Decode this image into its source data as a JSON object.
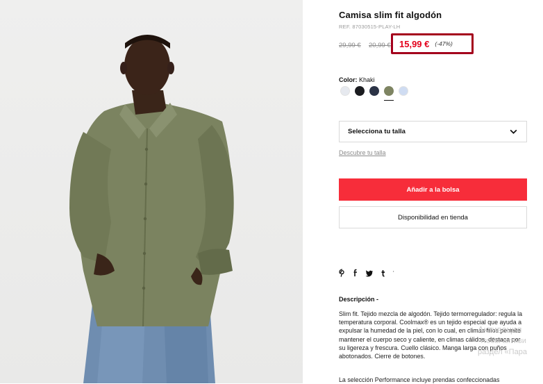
{
  "product": {
    "title": "Camisa slim fit algodón",
    "ref": "REF. 87030515-PLAY-LH",
    "old_price_1": "29,99 €",
    "old_price_2": "20,99 €",
    "price": "15,99 €",
    "discount": "(-47%)",
    "color_label": "Color:",
    "color_value": "Khaki",
    "swatches": [
      {
        "name": "white",
        "color": "#e6e9ef"
      },
      {
        "name": "black",
        "color": "#1b1c20"
      },
      {
        "name": "navy",
        "color": "#2b3346"
      },
      {
        "name": "khaki",
        "color": "#7e8462",
        "selected": true
      },
      {
        "name": "light-blue",
        "color": "#cfdcf2"
      }
    ],
    "size_select": "Selecciona tu talla",
    "size_link": "Descubre tu talla",
    "add_button": "Añadir a la bolsa",
    "store_button": "Disponibilidad en tienda",
    "social": [
      "p",
      "f",
      "t",
      "t"
    ],
    "description_title": "Descripción  -",
    "description": "Slim fit. Tejido mezcla de algodón. Tejido termorregulador: regula la temperatura corporal. Coolmax® es un tejido especial que ayuda a expulsar la humedad de la piel, con lo cual, en climas fríos permite mantener el cuerpo seco y caliente, en climas cálidos, destaca por su ligereza y frescura. Cuello clásico. Manga larga con puños abotonados. Cierre de botones.",
    "description_more": "La selección Performance incluye prendas confeccionadas"
  },
  "watermark": [
    "Активация",
    "Чтобы активи",
    "раздел «Пара"
  ],
  "colors": {
    "accent_red": "#f72d3a",
    "price_red": "#e3001b",
    "highlight_box": "#a4001c"
  }
}
